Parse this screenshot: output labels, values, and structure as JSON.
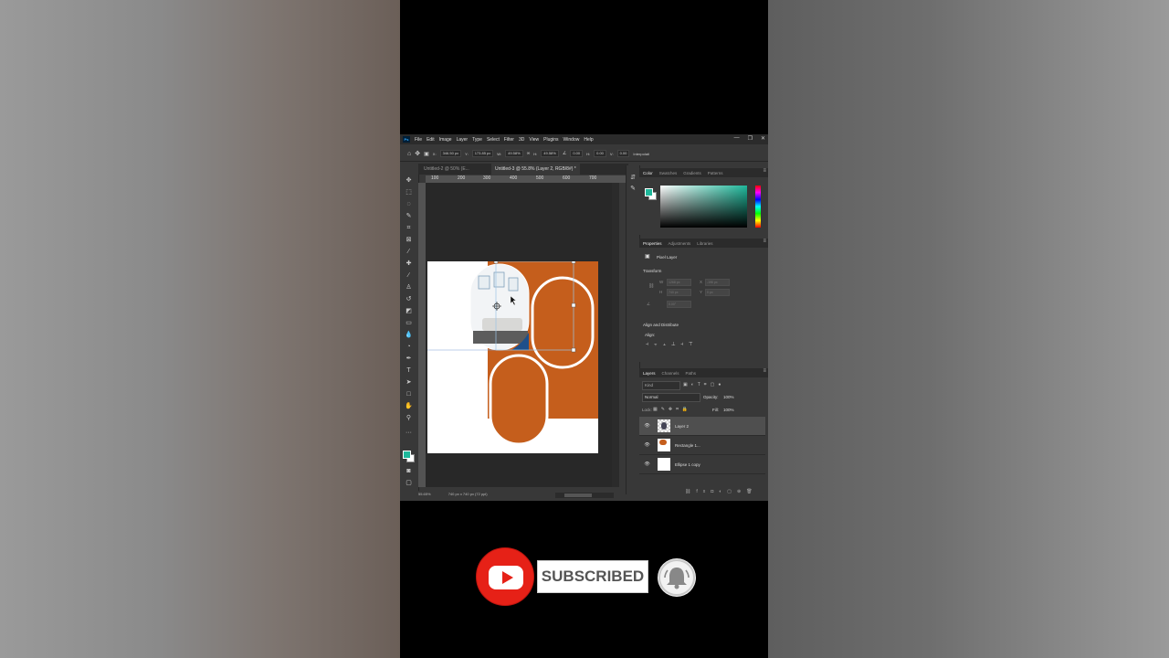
{
  "menu": {
    "logo": "Ps",
    "items": [
      "File",
      "Edit",
      "Image",
      "Layer",
      "Type",
      "Select",
      "Filter",
      "3D",
      "View",
      "Plugins",
      "Window",
      "Help"
    ],
    "window_controls": [
      "—",
      "❐",
      "✕"
    ]
  },
  "options": {
    "x_label": "X:",
    "x_value": "346.50 px",
    "y_label": "Y:",
    "y_value": "173.85 px",
    "w_label": "W:",
    "w_value": "49.58%",
    "h_label": "H:",
    "h_value": "49.58%",
    "angle_value": "0.00",
    "h_skew_label": "H:",
    "h_skew_value": "0.00",
    "v_skew_label": "V:",
    "v_skew_value": "0.00",
    "interpolation": "Interpolati"
  },
  "tabs": [
    {
      "label": "Untitled-2 @ 50% (E..."
    },
    {
      "label": "Untitled-3 @ 55.8% (Layer 2, RGB/8#) *"
    }
  ],
  "ruler_top": [
    "100",
    "200",
    "300",
    "400",
    "500",
    "600",
    "700"
  ],
  "status": {
    "zoom": "55.65%",
    "doc_info": "740 px x 740 px (72 ppi)"
  },
  "color_panel": {
    "tabs": [
      "Color",
      "Swatches",
      "Gradients",
      "Patterns"
    ],
    "fg_color": "#1fb89b"
  },
  "properties_panel": {
    "tabs": [
      "Properties",
      "Adjustments",
      "Libraries"
    ],
    "layer_type": "Pixel Layer",
    "transform_title": "Transform",
    "w_label": "W",
    "w_value": "1268 px",
    "x_label": "X",
    "x_value": "-196 px",
    "h_label": "H",
    "h_value": "740 px",
    "y_label": "Y",
    "y_value": "0 px",
    "angle_value": "0.00°",
    "align_title": "Align and Distribute",
    "align_label": "Align:"
  },
  "layers_panel": {
    "tabs": [
      "Layers",
      "Channels",
      "Paths"
    ],
    "kind_label": "Kind",
    "blend_mode": "Normal",
    "opacity_label": "Opacity:",
    "opacity_value": "100%",
    "lock_label": "Lock:",
    "fill_label": "Fill:",
    "fill_value": "100%",
    "layers": [
      {
        "name": "Layer 2",
        "selected": true
      },
      {
        "name": "Rectangle 1...",
        "selected": false
      },
      {
        "name": "Ellipse 1 copy",
        "selected": false
      }
    ]
  },
  "overlay": {
    "subscribe_label": "SUBSCRIBED",
    "youtube_color": "#e62117"
  }
}
